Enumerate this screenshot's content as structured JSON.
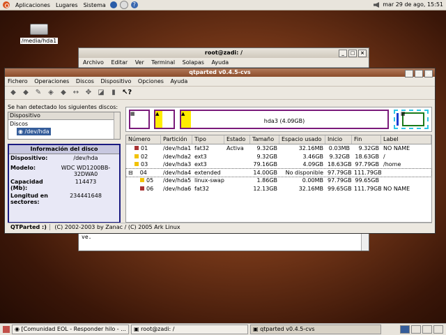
{
  "top_panel": {
    "menus": [
      "Aplicaciones",
      "Lugares",
      "Sistema"
    ],
    "clock": "mar 29 de ago, 15:51"
  },
  "desktop": {
    "icon_label": "/media/hda1"
  },
  "terminal": {
    "title": "root@zadi: /",
    "menu": [
      "Archivo",
      "Editar",
      "Ver",
      "Terminal",
      "Solapas",
      "Ayuda"
    ],
    "text": "ve."
  },
  "qtparted": {
    "title": "qtparted v0.4.5-cvs",
    "menu": [
      "Fichero",
      "Operaciones",
      "Discos",
      "Dispositivo",
      "Opciones",
      "Ayuda"
    ],
    "detected_label": "Se han detectado los siguientes discos:",
    "device_header": "Dispositivo",
    "discos_label": "Discos",
    "selected_device": "/dev/hda",
    "info": {
      "title": "Información del disco",
      "rows": [
        {
          "k": "Dispositivo:",
          "v": "/dev/hda"
        },
        {
          "k": "Modelo:",
          "v": "WDC WD1200BB-32DWA0"
        },
        {
          "k": "Capacidad (Mb):",
          "v": "114473"
        },
        {
          "k": "Longitud en sectores:",
          "v": "234441648"
        }
      ]
    },
    "diskmap": {
      "hda3_label": "hda3 (4.09GB)"
    },
    "columns": [
      "Número",
      "Partición",
      "Tipo",
      "Estado",
      "Tamaño",
      "Espacio usado",
      "Inicio",
      "Fin",
      "Label"
    ],
    "rows": [
      {
        "num": "01",
        "part": "/dev/hda1",
        "type": "fat32",
        "state": "Activa",
        "size": "9.32GB",
        "used": "32.16MB",
        "start": "0.03MB",
        "end": "9.32GB",
        "label": "NO NAME"
      },
      {
        "num": "02",
        "part": "/dev/hda2",
        "type": "ext3",
        "state": "",
        "size": "9.32GB",
        "used": "3.46GB",
        "start": "9.32GB",
        "end": "18.63GB",
        "label": "/"
      },
      {
        "num": "03",
        "part": "/dev/hda3",
        "type": "ext3",
        "state": "",
        "size": "79.16GB",
        "used": "4.09GB",
        "start": "18.63GB",
        "end": "97.79GB",
        "label": "/home"
      },
      {
        "num": "04",
        "part": "/dev/hda4",
        "type": "extended",
        "state": "",
        "size": "14.00GB",
        "used": "No disponible",
        "start": "97.79GB",
        "end": "111.79GB",
        "label": ""
      },
      {
        "num": "05",
        "part": "/dev/hda5",
        "type": "linux-swap",
        "state": "",
        "size": "1.86GB",
        "used": "0.00MB",
        "start": "97.79GB",
        "end": "99.65GB",
        "label": ""
      },
      {
        "num": "06",
        "part": "/dev/hda6",
        "type": "fat32",
        "state": "",
        "size": "12.13GB",
        "used": "32.16MB",
        "start": "99.65GB",
        "end": "111.79GB",
        "label": "NO NAME"
      }
    ],
    "status": {
      "left": "QTParted :)",
      "right": "(C) 2002-2003 by Zanac / (C) 2005 Ark Linux"
    }
  },
  "taskbar": {
    "tasks": [
      "[Comunidad EOL - Responder hilo - ...",
      "root@zadi: /",
      "qtparted v0.4.5-cvs"
    ]
  }
}
